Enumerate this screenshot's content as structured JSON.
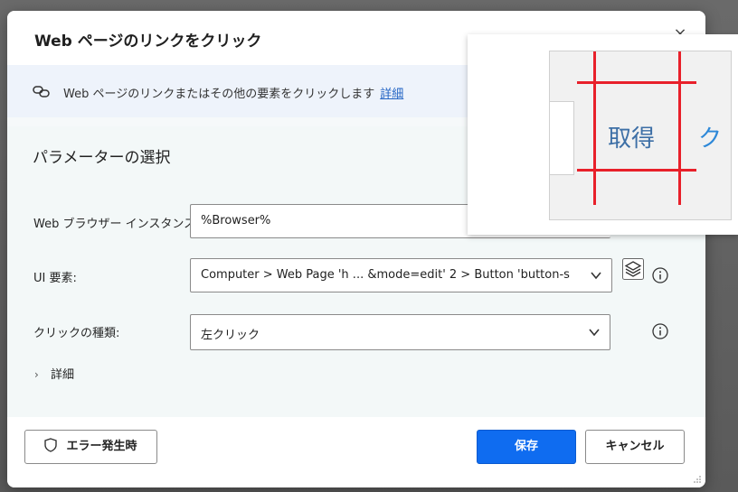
{
  "dialog": {
    "title": "Web ページのリンクをクリック",
    "close_label": "×"
  },
  "info": {
    "text": "Web ページのリンクまたはその他の要素をクリックします",
    "link": "詳細"
  },
  "params": {
    "section_title": "パラメーターの選択",
    "browser_label": "Web ブラウザー インスタンス:",
    "browser_value": "%Browser%",
    "ui_element_label": "UI 要素:",
    "ui_element_value": "Computer > Web Page 'h ... &mode=edit' 2 > Button 'button-s",
    "click_type_label": "クリックの種類:",
    "click_type_value": "左クリック",
    "details_label": "詳細"
  },
  "footer": {
    "error_button": "エラー発生時",
    "save_button": "保存",
    "cancel_button": "キャンセル"
  },
  "preview": {
    "button_text": "取得",
    "next_text": "ク"
  },
  "colors": {
    "accent": "#0f6cf0",
    "link": "#2163c4",
    "highlight": "#e8202a"
  },
  "icons": [
    "link-icon",
    "chevron-down-icon",
    "info-icon",
    "layers-icon",
    "shield-icon",
    "chevron-right-icon",
    "close-icon"
  ]
}
